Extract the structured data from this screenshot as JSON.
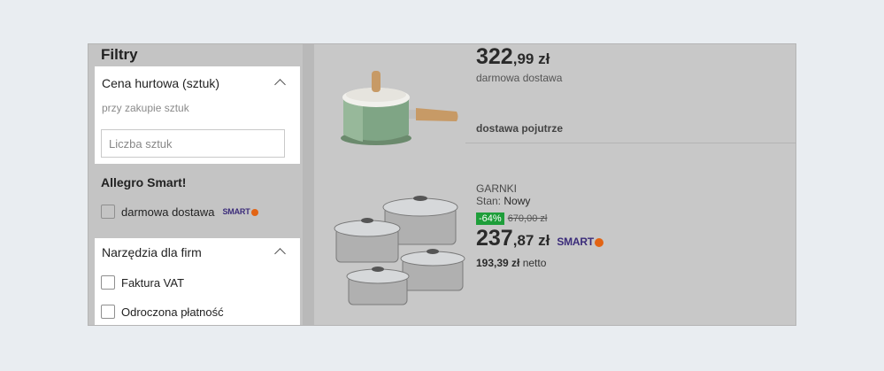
{
  "sidebar": {
    "title": "Filtry",
    "cena_hurtowa": {
      "heading": "Cena hurtowa (sztuk)",
      "hint": "przy zakupie sztuk",
      "input_placeholder": "Liczba sztuk",
      "input_value": ""
    },
    "allegro_smart": {
      "heading": "Allegro Smart!",
      "option_label": "darmowa dostawa",
      "badge": "SMART"
    },
    "narzedzia": {
      "heading": "Narzędzia dla firm",
      "options": [
        "Faktura VAT",
        "Odroczona płatność"
      ]
    }
  },
  "listing": {
    "item1": {
      "price_whole": "322",
      "price_fraction": ",99 zł",
      "shipping": "darmowa dostawa",
      "delivery": "dostawa pojutrze"
    },
    "item2": {
      "category": "GARNKI",
      "condition_label": "Stan: ",
      "condition_value": "Nowy",
      "discount": "-64%",
      "old_price": "670,00 zł",
      "price_whole": "237",
      "price_fraction": ",87 zł",
      "badge": "SMART",
      "net_price": "193,39 zł",
      "net_label": " netto"
    }
  },
  "colors": {
    "smart": "#3b2c7a",
    "smart_dot": "#e26414",
    "discount_bg": "#1e9e3a"
  }
}
